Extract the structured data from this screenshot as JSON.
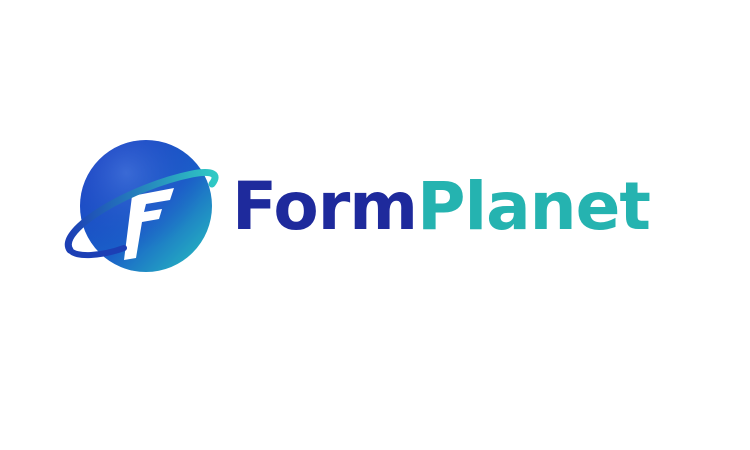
{
  "brand": {
    "name_part_1": "Form",
    "name_part_2": "Planet",
    "colors": {
      "primary_blue": "#1e2a9c",
      "accent_teal": "#25b3b0",
      "globe_dark": "#1a3fb8",
      "globe_light": "#26c3c0",
      "background": "#ffffff"
    },
    "logo_icon": "globe-with-orbit-icon"
  }
}
